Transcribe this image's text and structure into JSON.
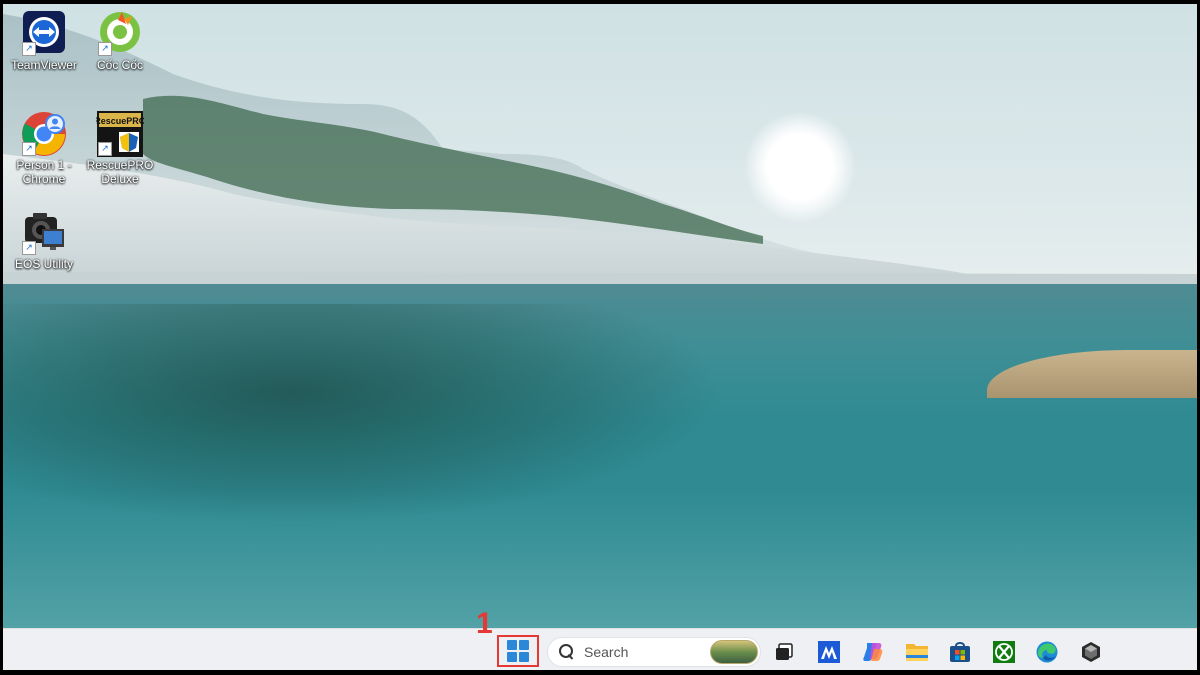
{
  "desktop": {
    "icons": [
      {
        "label": "TeamViewer",
        "icon": "teamviewer-icon"
      },
      {
        "label": "Cốc Cốc",
        "icon": "coccoc-icon"
      },
      {
        "label": "Person 1 - Chrome",
        "line1": "Person 1 -",
        "line2": "Chrome",
        "icon": "chrome-icon"
      },
      {
        "label": "RescuePRO Deluxe",
        "line1": "RescuePRO",
        "line2": "Deluxe",
        "icon": "rescuepro-icon"
      },
      {
        "label": "EOS Utility",
        "icon": "eos-utility-icon"
      }
    ]
  },
  "annotation": {
    "step": "1",
    "color": "#e53935"
  },
  "taskbar": {
    "start": {
      "icon": "windows-start-icon"
    },
    "search": {
      "placeholder": "Search",
      "icon": "search-icon"
    },
    "pinned": [
      {
        "name": "task-view",
        "icon": "task-view-icon"
      },
      {
        "name": "malwarebytes",
        "icon": "malwarebytes-icon"
      },
      {
        "name": "copilot",
        "icon": "copilot-icon"
      },
      {
        "name": "file-explorer",
        "icon": "folder-icon"
      },
      {
        "name": "microsoft-store",
        "icon": "store-icon"
      },
      {
        "name": "xbox",
        "icon": "xbox-icon"
      },
      {
        "name": "edge",
        "icon": "edge-icon"
      },
      {
        "name": "app",
        "icon": "cube-app-icon"
      }
    ],
    "accent": "#2b88d8"
  }
}
